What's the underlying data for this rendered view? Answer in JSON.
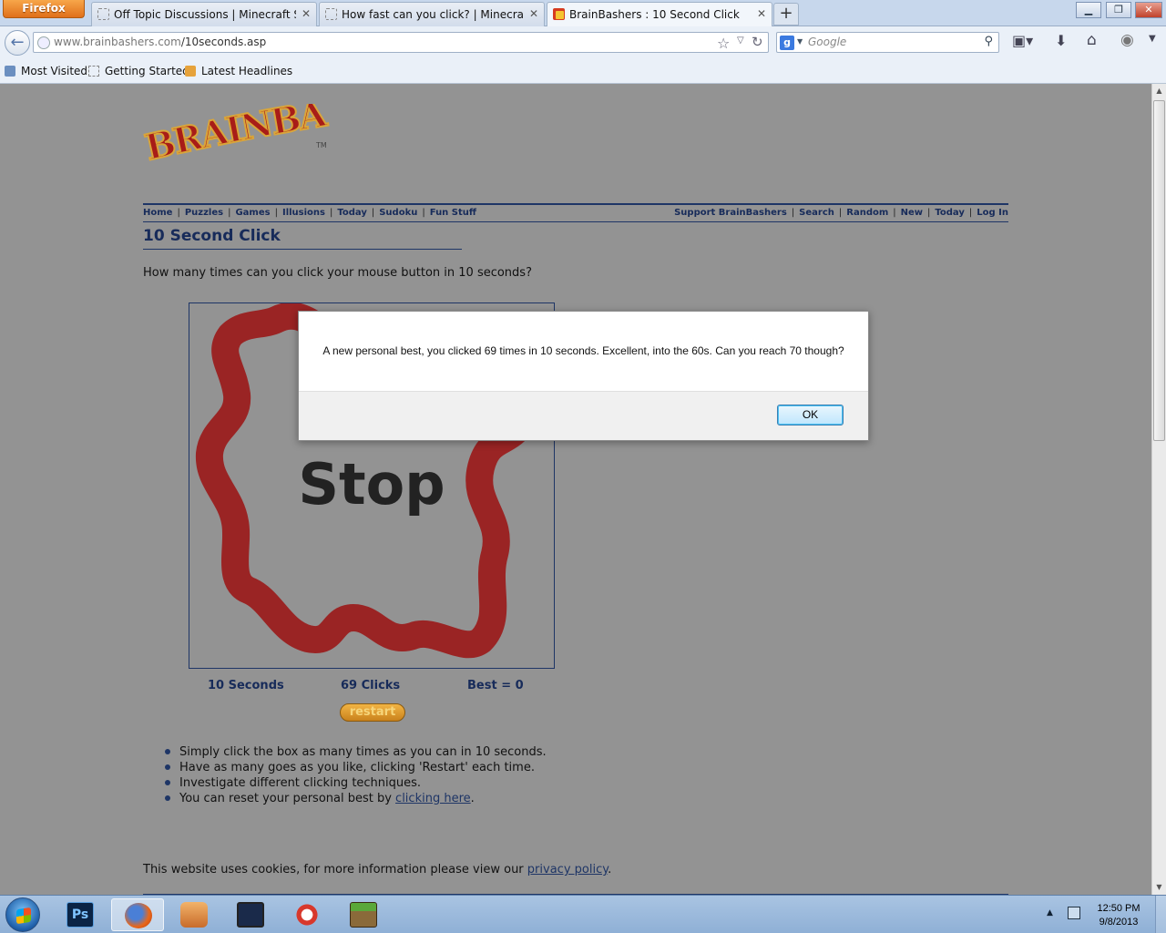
{
  "browser": {
    "app_button": "Firefox",
    "tabs": [
      {
        "label": "Off Topic Discussions | Minecraft Sur...",
        "active": false
      },
      {
        "label": "How fast can you click? | Minecraft S...",
        "active": false
      },
      {
        "label": "BrainBashers : 10 Second Click",
        "active": true
      }
    ],
    "url_host": "www.brainbashers.com",
    "url_path": "/10seconds.asp",
    "search_placeholder": "Google",
    "bookmarks": [
      "Most Visited",
      "Getting Started",
      "Latest Headlines"
    ]
  },
  "site": {
    "logo_text": "BRAINBASHERS",
    "logo_tm": "TM",
    "nav_left": [
      "Home",
      "Puzzles",
      "Games",
      "Illusions",
      "Today",
      "Sudoku",
      "Fun Stuff"
    ],
    "nav_right": [
      "Support BrainBashers",
      "Search",
      "Random",
      "New",
      "Today",
      "Log In"
    ]
  },
  "page": {
    "title": "10 Second Click",
    "question": "How many times can you click your mouse button in 10 seconds?",
    "box_label": "Stop",
    "stats": {
      "time": "10 Seconds",
      "clicks": "69 Clicks",
      "best": "Best = 0"
    },
    "restart_label": "restart",
    "bullets": [
      "Simply click the box as many times as you can in 10 seconds.",
      "Have as many goes as you like, clicking 'Restart' each time.",
      "Investigate different clicking techniques."
    ],
    "reset_prefix": "You can reset your personal best by ",
    "reset_link": "clicking here",
    "reset_suffix": ".",
    "cookie_prefix": "This website uses cookies, for more information please view our ",
    "cookie_link": "privacy policy",
    "cookie_suffix": "."
  },
  "alert": {
    "message": "A new personal best, you clicked 69 times in 10 seconds. Excellent, into the 60s. Can you reach 70 though?",
    "ok_label": "OK"
  },
  "taskbar": {
    "time": "12:50 PM",
    "date": "9/8/2013"
  },
  "colors": {
    "brand_navy": "#1e3566",
    "scribble_red": "#9a2424",
    "overlay_gray": "#939393"
  }
}
